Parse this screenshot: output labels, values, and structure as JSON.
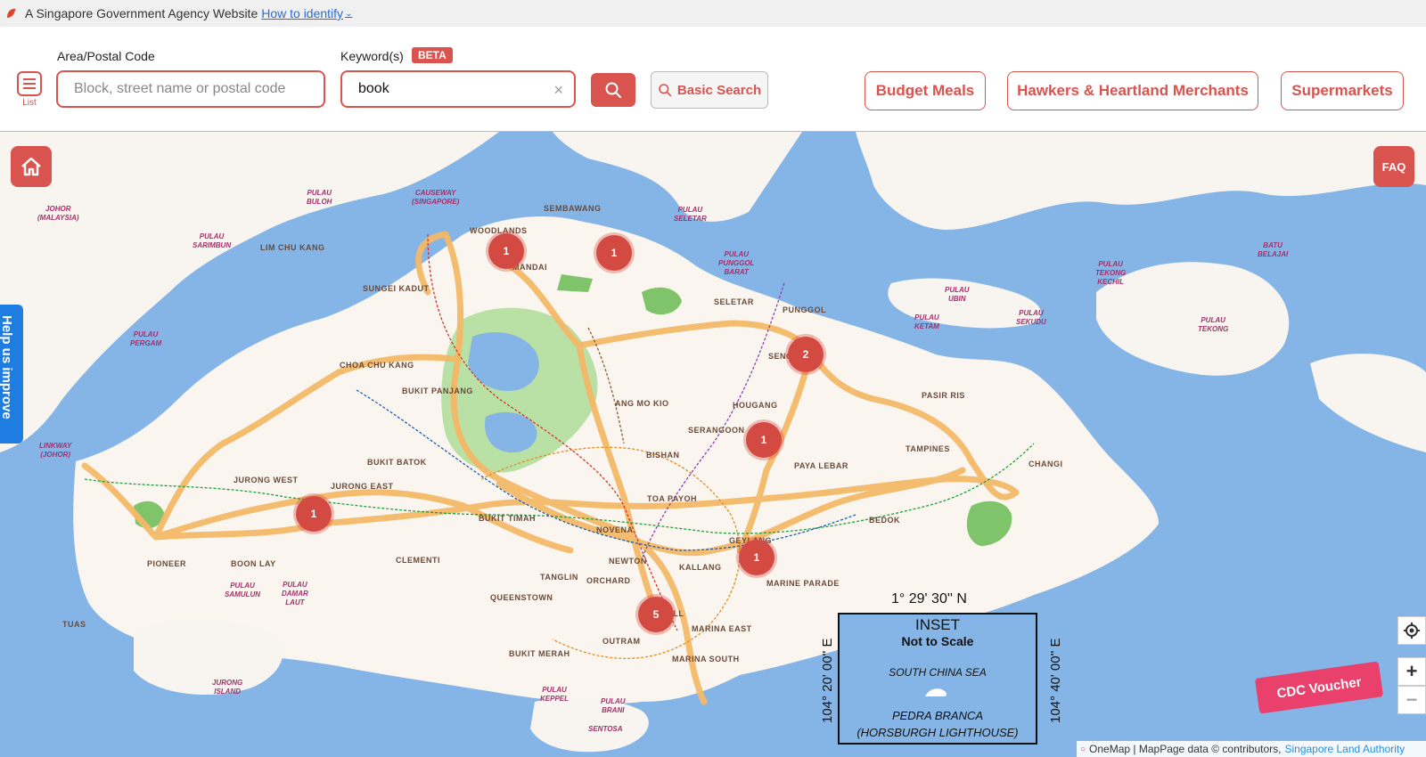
{
  "masthead": {
    "text": "A Singapore Government Agency Website",
    "link": "How to identify"
  },
  "search": {
    "list_label": "List",
    "area_label": "Area/Postal Code",
    "area_placeholder": "Block, street name or postal code",
    "area_value": "",
    "keyword_label": "Keyword(s)",
    "beta_badge": "BETA",
    "keyword_value": "book",
    "basic_search": "Basic Search"
  },
  "categories": [
    "Budget Meals",
    "Hawkers & Heartland Merchants",
    "Supermarkets"
  ],
  "map": {
    "faq": "FAQ",
    "help_tab": "Help us improve",
    "voucher": "CDC Voucher",
    "attribution": "OneMap | MapPage data © contributors,",
    "attribution_link": "Singapore Land Authority",
    "inset": {
      "top_coord": "1° 29' 30'' N",
      "left_coord": "104° 20' 00'' E",
      "right_coord": "104° 40' 00'' E",
      "title": "INSET",
      "subtitle": "Not to Scale",
      "sea": "SOUTH CHINA SEA",
      "island": "PEDRA BRANCA",
      "island_sub": "(HORSBURGH LIGHTHOUSE)"
    },
    "clusters": [
      "1",
      "1",
      "2",
      "1",
      "1",
      "1",
      "5"
    ],
    "places": [
      "WOODLANDS",
      "MANDAI",
      "SEMBAWANG",
      "LIM CHU KANG",
      "SUNGEI KADUT",
      "SELETAR",
      "PUNGGOL",
      "SENGKANG",
      "HOUGANG",
      "SERANGOON",
      "ANG MO KIO",
      "CHOA CHU KANG",
      "BUKIT PANJANG",
      "BUKIT BATOK",
      "JURONG WEST",
      "JURONG EAST",
      "BISHAN",
      "TOA PAYOH",
      "PAYA LEBAR",
      "PASIR RIS",
      "TAMPINES",
      "CHANGI",
      "BEDOK",
      "BUKIT TIMAH",
      "NOVENA",
      "GEYLANG",
      "KALLANG",
      "NEWTON",
      "TANGLIN",
      "ORCHARD",
      "CLEMENTI",
      "QUEENSTOWN",
      "PIONEER",
      "BOON LAY",
      "TUAS",
      "MARINE PARADE",
      "CITY HALL",
      "MARINA EAST",
      "MARINA SOUTH",
      "OUTRAM",
      "BUKIT MERAH"
    ],
    "islands": [
      "JOHOR\n(MALAYSIA)",
      "CAUSEWAY\n(SINGAPORE)",
      "PULAU\nBULOH",
      "PULAU\nSARIMBUN",
      "PULAU\nSELETAR",
      "PULAU\nPUNGGOL\nBARAT",
      "PULAU\nUBIN",
      "PULAU\nKETAM",
      "PULAU\nSEKUDU",
      "PULAU\nTEKONG\nKECHIL",
      "PULAU\nTEKONG",
      "BATU\nBELAJAI",
      "PULAU\nPERGAM",
      "LINKWAY\n(JOHOR)",
      "PULAU\nSAMULUN",
      "PULAU\nDAMAR\nLAUT",
      "JURONG\nISLAND",
      "PULAU\nKEPPEL",
      "PULAU\nBRANI",
      "SENTOSA"
    ]
  }
}
